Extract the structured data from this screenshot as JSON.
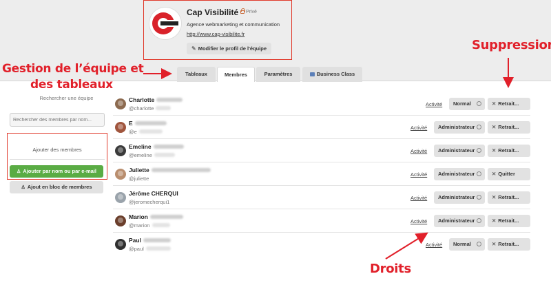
{
  "team": {
    "name": "Cap Visibilité",
    "privacy": "Privé",
    "description": "Agence webmarketing et communication",
    "url": "http://www.cap-visibilite.fr",
    "edit_label": "Modifier le profil de l'équipe",
    "logo_text": "CAP VISIBILITE"
  },
  "tabs": [
    {
      "label": "Tableaux"
    },
    {
      "label": "Membres"
    },
    {
      "label": "Paramètres"
    },
    {
      "label": "Business Class"
    }
  ],
  "annotations": {
    "gestion": "Gestion de l’équipe et",
    "gestion2": "des tableaux",
    "suppression": "Suppression",
    "droits": "Droits"
  },
  "sidebar": {
    "title": "Rechercher une équipe",
    "search_placeholder": "Rechercher des membres par nom...",
    "add_title": "Ajouter des membres",
    "add_by_name": "Ajouter par nom ou par e-mail",
    "bulk_add": "Ajout en bloc de membres"
  },
  "members": [
    {
      "name": "Charlotte",
      "username": "@charlotte",
      "activity": "Activité",
      "role": "Normal",
      "action": "Retrait..."
    },
    {
      "name": "E",
      "username": "@e",
      "activity": "Activité",
      "role": "Administrateur",
      "action": "Retrait..."
    },
    {
      "name": "Emeline",
      "username": "@emeline",
      "activity": "Activité",
      "role": "Administrateur",
      "action": "Retrait..."
    },
    {
      "name": "Juliette",
      "username": "@juliette",
      "activity": "Activité",
      "role": "Administrateur",
      "action": "Quitter"
    },
    {
      "name": "Jérôme CHERQUI",
      "username": "@jeromecherqui1",
      "activity": "Activité",
      "role": "Administrateur",
      "action": "Retrait..."
    },
    {
      "name": "Marion",
      "username": "@marion",
      "activity": "Activité",
      "role": "Administrateur",
      "action": "Retrait..."
    },
    {
      "name": "Paul",
      "username": "@paul",
      "activity": "Activité",
      "role": "Normal",
      "action": "Retrait..."
    }
  ],
  "colors": {
    "accent_red": "#e1202a",
    "green": "#5aac44"
  }
}
